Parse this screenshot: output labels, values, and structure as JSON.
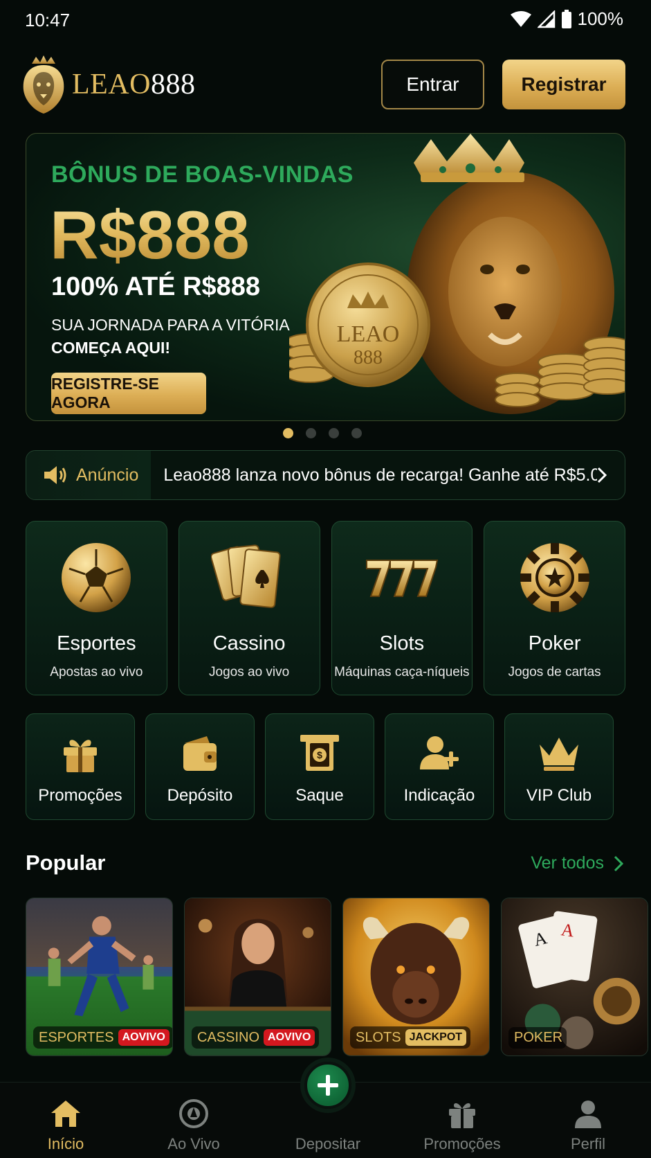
{
  "status": {
    "time": "10:47",
    "battery": "100%"
  },
  "header": {
    "logo_part1": "LEAO",
    "logo_part2": "888",
    "login_label": "Entrar",
    "register_label": "Registrar"
  },
  "banner": {
    "subtitle": "BÔNUS DE BOAS-VINDAS",
    "amount": "R$888",
    "offer": "100% ATÉ R$888",
    "desc_line1": "SUA JORNADA PARA A VITÓRIA",
    "desc_line2": "COMEÇA AQUI!",
    "cta": "REGISTRE-SE AGORA",
    "coin_line1": "LEAO",
    "coin_line2": "888",
    "slide_count": 4,
    "active_slide": 1
  },
  "announcement": {
    "label": "Anúncio",
    "text": "Leao888 lanza novo bônus de recarga! Ganhe até R$5.0..."
  },
  "categories": [
    {
      "title": "Esportes",
      "subtitle": "Apostas ao vivo",
      "icon": "soccer-ball-icon"
    },
    {
      "title": "Cassino",
      "subtitle": "Jogos ao vivo",
      "icon": "playing-cards-icon"
    },
    {
      "title": "Slots",
      "subtitle": "Máquinas caça-níqueis",
      "icon": "slot-777-icon"
    },
    {
      "title": "Poker",
      "subtitle": "Jogos de cartas",
      "icon": "poker-chip-icon"
    }
  ],
  "quick_actions": [
    {
      "label": "Promoções",
      "icon": "gift-icon"
    },
    {
      "label": "Depósito",
      "icon": "wallet-icon"
    },
    {
      "label": "Saque",
      "icon": "withdraw-icon"
    },
    {
      "label": "Indicação",
      "icon": "add-user-icon"
    },
    {
      "label": "VIP Club",
      "icon": "crown-icon"
    }
  ],
  "popular": {
    "title": "Popular",
    "see_all": "Ver todos",
    "items": [
      {
        "label": "ESPORTES",
        "badge": "AOVIVO"
      },
      {
        "label": "CASSINO",
        "badge": "AOVIVO"
      },
      {
        "label": "SLOTS",
        "badge": "JACKPOT"
      },
      {
        "label": "POKER",
        "badge": ""
      }
    ]
  },
  "bottom_nav": {
    "home": "Início",
    "live": "Ao Vivo",
    "deposit": "Depositar",
    "promotions": "Promoções",
    "profile": "Perfil",
    "active": "home"
  },
  "colors": {
    "gold": "#e3bd62",
    "green_accent": "#2eaa5c",
    "background": "#050b08",
    "live_red": "#d4181f"
  }
}
